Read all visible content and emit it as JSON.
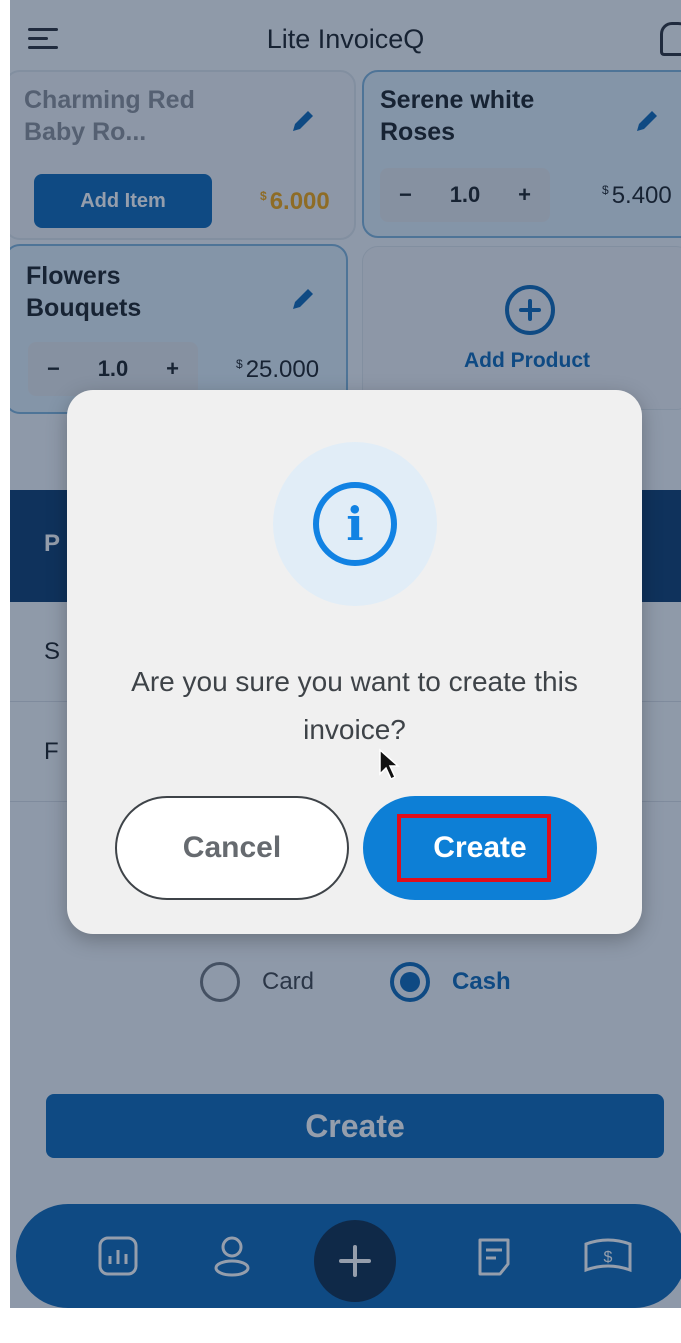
{
  "header": {
    "title": "Lite InvoiceQ"
  },
  "products": [
    {
      "name": "Charming Red Baby Ro...",
      "action_label": "Add Item",
      "currency": "$",
      "price": "6.000"
    },
    {
      "name": "Serene white Roses",
      "quantity": "1.0",
      "currency": "$",
      "price": "5.400"
    },
    {
      "name": "Flowers Bouquets",
      "quantity": "1.0",
      "currency": "$",
      "price": "25.000"
    }
  ],
  "add_product": {
    "label": "Add Product"
  },
  "stepper": {
    "minus": "−",
    "plus": "+"
  },
  "table": {
    "header_initial": "P",
    "rows": [
      "S",
      "F"
    ]
  },
  "payment": {
    "options": [
      {
        "label": "Card",
        "selected": false
      },
      {
        "label": "Cash",
        "selected": true
      }
    ]
  },
  "main_create_label": "Create",
  "bottom_nav": {
    "items": [
      "reports-icon",
      "customer-icon",
      "add-icon",
      "invoice-icon",
      "payment-icon"
    ]
  },
  "dialog": {
    "icon": "info-icon",
    "icon_glyph": "i",
    "message": "Are you sure you want to create this invoice?",
    "cancel_label": "Cancel",
    "create_label": "Create"
  },
  "colors": {
    "accent": "#0b67b5",
    "price_highlight": "#f2a50c",
    "highlight_box": "#e10d1a"
  }
}
